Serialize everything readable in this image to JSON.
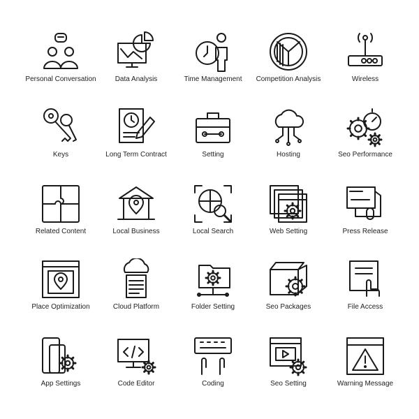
{
  "icons": [
    {
      "label": "Personal Conversation",
      "icon": "people-chat-icon"
    },
    {
      "label": "Data Analysis",
      "icon": "monitor-chart-icon"
    },
    {
      "label": "Time Management",
      "icon": "clock-person-icon"
    },
    {
      "label": "Competition Analysis",
      "icon": "pie-chart-icon"
    },
    {
      "label": "Wireless",
      "icon": "router-icon"
    },
    {
      "label": "Keys",
      "icon": "keys-icon"
    },
    {
      "label": "Long Term Contract",
      "icon": "contract-clock-icon"
    },
    {
      "label": "Setting",
      "icon": "toolbox-icon"
    },
    {
      "label": "Hosting",
      "icon": "cloud-network-icon"
    },
    {
      "label": "Seo Performance",
      "icon": "gears-stopwatch-icon"
    },
    {
      "label": "Related Content",
      "icon": "puzzle-icon"
    },
    {
      "label": "Local Business",
      "icon": "bank-pin-icon"
    },
    {
      "label": "Local Search",
      "icon": "globe-search-icon"
    },
    {
      "label": "Web Setting",
      "icon": "browser-gear-icon"
    },
    {
      "label": "Press Release",
      "icon": "press-document-icon"
    },
    {
      "label": "Place Optimization",
      "icon": "browser-pin-icon"
    },
    {
      "label": "Cloud Platform",
      "icon": "cloud-document-icon"
    },
    {
      "label": "Folder Setting",
      "icon": "folder-gear-icon"
    },
    {
      "label": "Seo Packages",
      "icon": "box-gear-icon"
    },
    {
      "label": "File Access",
      "icon": "file-hand-icon"
    },
    {
      "label": "App Settings",
      "icon": "phone-gear-icon"
    },
    {
      "label": "Code Editor",
      "icon": "monitor-code-icon"
    },
    {
      "label": "Coding",
      "icon": "keyboard-hands-icon"
    },
    {
      "label": "Seo Setting",
      "icon": "video-gear-icon"
    },
    {
      "label": "Warning Message",
      "icon": "browser-warning-icon"
    }
  ]
}
